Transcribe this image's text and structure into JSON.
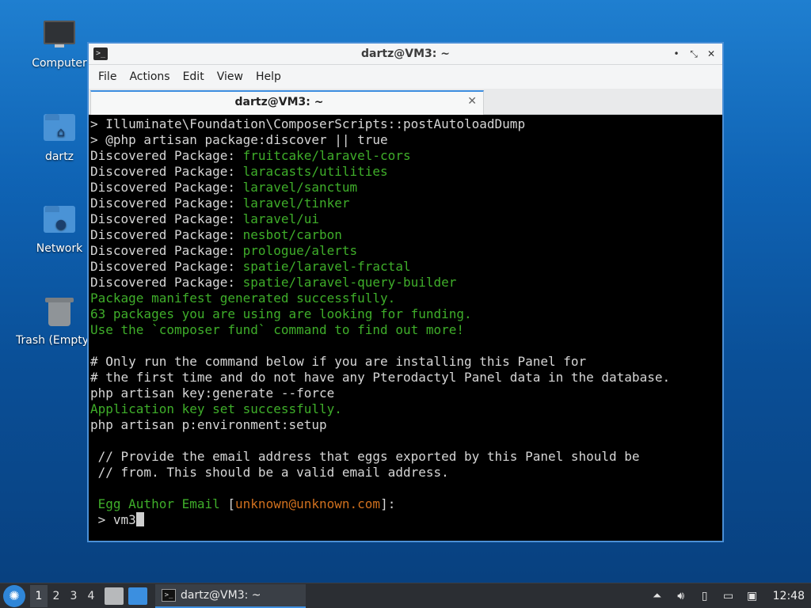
{
  "desktop": {
    "icons": [
      {
        "label": "Computer"
      },
      {
        "label": "dartz"
      },
      {
        "label": "Network"
      },
      {
        "label": "Trash (Empty)"
      }
    ]
  },
  "window": {
    "title": "dartz@VM3: ~",
    "menu": [
      "File",
      "Actions",
      "Edit",
      "View",
      "Help"
    ],
    "tab_label": "dartz@VM3: ~",
    "terminal": {
      "lines": [
        {
          "segments": [
            {
              "text": "> Illuminate\\Foundation\\ComposerScripts::postAutoloadDump",
              "color": "w"
            }
          ]
        },
        {
          "segments": [
            {
              "text": "> @php artisan package:discover || true",
              "color": "w"
            }
          ]
        },
        {
          "segments": [
            {
              "text": "Discovered Package: ",
              "color": "w"
            },
            {
              "text": "fruitcake/laravel-cors",
              "color": "g"
            }
          ]
        },
        {
          "segments": [
            {
              "text": "Discovered Package: ",
              "color": "w"
            },
            {
              "text": "laracasts/utilities",
              "color": "g"
            }
          ]
        },
        {
          "segments": [
            {
              "text": "Discovered Package: ",
              "color": "w"
            },
            {
              "text": "laravel/sanctum",
              "color": "g"
            }
          ]
        },
        {
          "segments": [
            {
              "text": "Discovered Package: ",
              "color": "w"
            },
            {
              "text": "laravel/tinker",
              "color": "g"
            }
          ]
        },
        {
          "segments": [
            {
              "text": "Discovered Package: ",
              "color": "w"
            },
            {
              "text": "laravel/ui",
              "color": "g"
            }
          ]
        },
        {
          "segments": [
            {
              "text": "Discovered Package: ",
              "color": "w"
            },
            {
              "text": "nesbot/carbon",
              "color": "g"
            }
          ]
        },
        {
          "segments": [
            {
              "text": "Discovered Package: ",
              "color": "w"
            },
            {
              "text": "prologue/alerts",
              "color": "g"
            }
          ]
        },
        {
          "segments": [
            {
              "text": "Discovered Package: ",
              "color": "w"
            },
            {
              "text": "spatie/laravel-fractal",
              "color": "g"
            }
          ]
        },
        {
          "segments": [
            {
              "text": "Discovered Package: ",
              "color": "w"
            },
            {
              "text": "spatie/laravel-query-builder",
              "color": "g"
            }
          ]
        },
        {
          "segments": [
            {
              "text": "Package manifest generated successfully.",
              "color": "g"
            }
          ]
        },
        {
          "segments": [
            {
              "text": "63 packages you are using are looking for funding.",
              "color": "g"
            }
          ]
        },
        {
          "segments": [
            {
              "text": "Use the `composer fund` command to find out more!",
              "color": "g"
            }
          ]
        },
        {
          "segments": [
            {
              "text": "",
              "color": "w"
            }
          ]
        },
        {
          "segments": [
            {
              "text": "# Only run the command below if you are installing this Panel for",
              "color": "w"
            }
          ]
        },
        {
          "segments": [
            {
              "text": "# the first time and do not have any Pterodactyl Panel data in the database.",
              "color": "w"
            }
          ]
        },
        {
          "segments": [
            {
              "text": "php artisan key:generate --force",
              "color": "w"
            }
          ]
        },
        {
          "segments": [
            {
              "text": "Application key set successfully.",
              "color": "g"
            }
          ]
        },
        {
          "segments": [
            {
              "text": "php artisan p:environment:setup",
              "color": "w"
            }
          ]
        },
        {
          "segments": [
            {
              "text": "",
              "color": "w"
            }
          ]
        },
        {
          "segments": [
            {
              "text": " // Provide the email address that eggs exported by this Panel should be",
              "color": "w"
            }
          ]
        },
        {
          "segments": [
            {
              "text": " // from. This should be a valid email address.",
              "color": "w"
            }
          ]
        },
        {
          "segments": [
            {
              "text": "",
              "color": "w"
            }
          ]
        },
        {
          "segments": [
            {
              "text": " Egg Author Email ",
              "color": "g"
            },
            {
              "text": "[",
              "color": "w"
            },
            {
              "text": "unknown@unknown.com",
              "color": "o"
            },
            {
              "text": "]:",
              "color": "w"
            }
          ]
        },
        {
          "segments": [
            {
              "text": " > vm3",
              "color": "w"
            }
          ],
          "cursor": true
        }
      ]
    }
  },
  "taskbar": {
    "workspaces": [
      "1",
      "2",
      "3",
      "4"
    ],
    "active_workspace": "1",
    "task_label": "dartz@VM3: ~",
    "clock": "12:48"
  },
  "colors": {
    "accent": "#3d8ee0",
    "term_green": "#3fae2a",
    "term_orange": "#d0701e",
    "term_text": "#d6d6d6"
  }
}
